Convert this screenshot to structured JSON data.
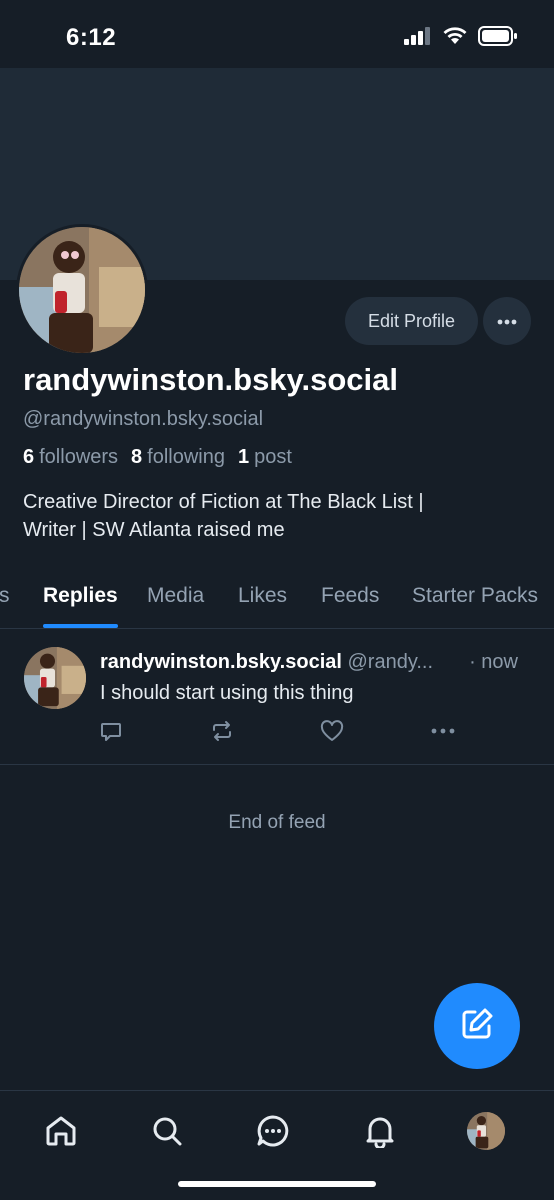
{
  "status_bar": {
    "time": "6:12",
    "icons": [
      "signal-icon",
      "wifi-icon",
      "battery-icon"
    ]
  },
  "profile": {
    "display_name": "randywinston.bsky.social",
    "handle": "@randywinston.bsky.social",
    "edit_profile_label": "Edit Profile",
    "followers_count": "6",
    "followers_label": "followers",
    "following_count": "8",
    "following_label": "following",
    "posts_count": "1",
    "posts_label": "post",
    "bio_line1": "Creative Director of Fiction at The Black List |",
    "bio_line2": "Writer | SW Atlanta raised me"
  },
  "tabs": {
    "items": [
      {
        "label": "Posts"
      },
      {
        "label": "Replies"
      },
      {
        "label": "Media"
      },
      {
        "label": "Likes"
      },
      {
        "label": "Feeds"
      },
      {
        "label": "Starter Packs"
      }
    ],
    "active": "Replies"
  },
  "post": {
    "author_name": "randywinston.bsky.social",
    "author_handle": "@randy...",
    "time": "· now",
    "text": "I should start using this thing"
  },
  "feed": {
    "end_label": "End of feed"
  },
  "bottom_nav": {
    "items": [
      "home-icon",
      "search-icon",
      "chat-icon",
      "bell-icon",
      "profile-avatar"
    ]
  },
  "colors": {
    "background": "#161e27",
    "banner": "#1f2b37",
    "accent": "#208bfe",
    "muted_text": "#8c9aa9",
    "button_bg": "#24303d"
  }
}
